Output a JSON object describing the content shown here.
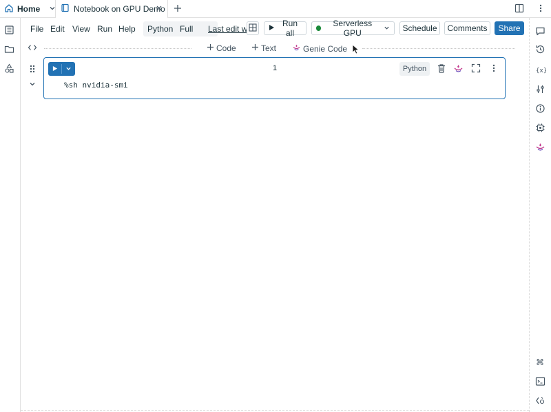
{
  "tabs": {
    "home_label": "Home",
    "notebook_label": "Notebook on GPU Demo"
  },
  "menu": {
    "items": [
      "File",
      "Edit",
      "View",
      "Run",
      "Help"
    ],
    "language": "Python",
    "mode": "Full",
    "last_edit": "Last edit was"
  },
  "toolbar": {
    "run_all": "Run all",
    "compute": "Serverless GPU",
    "schedule": "Schedule",
    "comments": "Comments",
    "share": "Share"
  },
  "inserts": {
    "code": "Code",
    "text": "Text",
    "genie": "Genie Code"
  },
  "cell": {
    "number": "1",
    "language": "Python",
    "code": "%sh nvidia-smi"
  },
  "colors": {
    "accent": "#2272b4",
    "compute_status": "#1b8a3a",
    "genie": "#c23a8e"
  }
}
